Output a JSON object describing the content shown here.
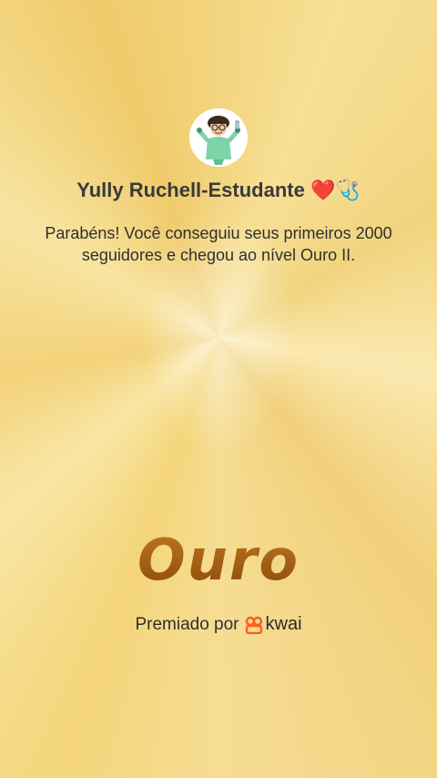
{
  "profile": {
    "avatar_icon": "nurse-character-avatar",
    "username": "Yully Ruchell-Estudante ❤️🩺"
  },
  "message": "Parabéns! Você conseguiu seus primeiros 2000 seguidores e chegou ao nível Ouro II.",
  "level": {
    "title": "Ouro"
  },
  "awarded": {
    "label": "Premiado por",
    "brand_icon": "kwai-logo-icon",
    "brand_name": "kwai"
  },
  "colors": {
    "background": "#f4d57a",
    "level_text": "#9a5a12",
    "brand_orange": "#ff5a1f"
  }
}
